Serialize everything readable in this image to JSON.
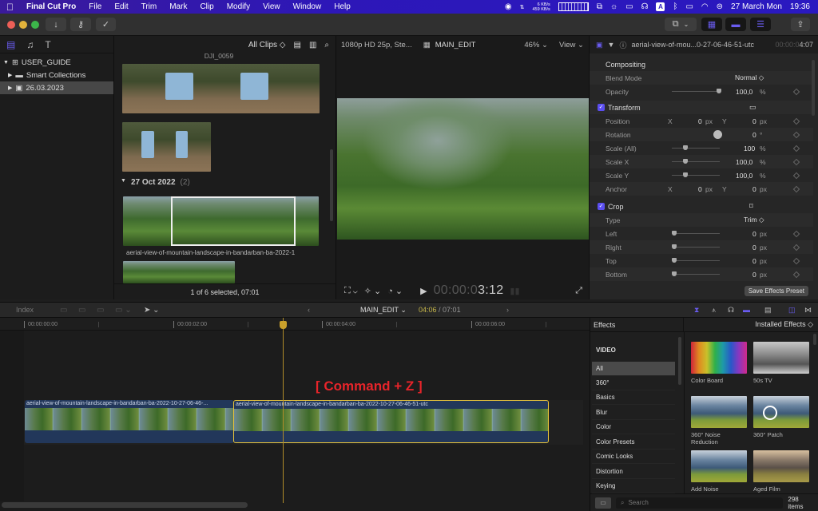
{
  "menubar": {
    "apple": "",
    "app_name": "Final Cut Pro",
    "menus": [
      "File",
      "Edit",
      "Trim",
      "Mark",
      "Clip",
      "Modify",
      "View",
      "Window",
      "Help"
    ],
    "net_up": "6 KB/s",
    "net_down": "459 KB/s",
    "input_source": "A",
    "date": "27 March Mon",
    "time": "19:36"
  },
  "toolbar": {
    "import_icon": "↓",
    "keyword_icon": "⚷",
    "check_icon": "✓"
  },
  "library": {
    "name": "USER_GUIDE",
    "items": [
      {
        "label": "Smart Collections",
        "icon": "folder-icon"
      },
      {
        "label": "26.03.2023",
        "icon": "event-icon",
        "selected": true
      }
    ]
  },
  "browser": {
    "filter": "All Clips",
    "clip1_name": "DJI_0059",
    "group_date": "27 Oct 2022",
    "group_count": "(2)",
    "clip2_name": "aerial-view-of-mountain-landscape-in-bandarban-ba-2022-1",
    "status": "1 of 6 selected, 07:01"
  },
  "viewer": {
    "format": "1080p HD 25p, Ste...",
    "project": "MAIN_EDIT",
    "zoom": "46%",
    "view_label": "View",
    "timecode_dim": "00:00:0",
    "timecode_lit": "3:12"
  },
  "inspector": {
    "clip_name": "aerial-view-of-mou...0-27-06-46-51-utc",
    "duration_dim": "00:00:0",
    "duration_lit": "4:07",
    "compositing": {
      "title": "Compositing",
      "blend_mode_label": "Blend Mode",
      "blend_mode_value": "Normal ◇",
      "opacity_label": "Opacity",
      "opacity_value": "100,0",
      "opacity_unit": "%"
    },
    "transform": {
      "title": "Transform",
      "position_label": "Position",
      "position_x": "0",
      "position_y": "0",
      "rotation_label": "Rotation",
      "rotation_value": "0",
      "rotation_unit": "°",
      "scale_all_label": "Scale (All)",
      "scale_all_value": "100",
      "scale_x_label": "Scale X",
      "scale_x_value": "100,0",
      "scale_y_label": "Scale Y",
      "scale_y_value": "100,0",
      "anchor_label": "Anchor",
      "anchor_x": "0",
      "anchor_y": "0",
      "unit_px": "px",
      "unit_pct": "%",
      "x_label": "X",
      "y_label": "Y"
    },
    "crop": {
      "title": "Crop",
      "type_label": "Type",
      "type_value": "Trim ◇",
      "left_label": "Left",
      "left_value": "0",
      "right_label": "Right",
      "right_value": "0",
      "top_label": "Top",
      "top_value": "0",
      "bottom_label": "Bottom",
      "bottom_value": "0"
    },
    "save_preset": "Save Effects Preset"
  },
  "timeline_bar": {
    "index": "Index",
    "project": "MAIN_EDIT",
    "position": "04:06",
    "duration": "/ 07:01"
  },
  "timeline": {
    "ticks": [
      "00:00:00:00",
      "00:00:02:00",
      "00:00:04:00",
      "00:00:06:00"
    ],
    "overlay": "[ Command + Z ]",
    "clips": [
      {
        "label": "aerial-view-of-mountain-landscape-in-bandarban-ba-2022-10-27-06-46-...",
        "selected": false
      },
      {
        "label": "aerial-view-of-mountain-landscape-in-bandarban-ba-2022-10-27-06-46-51-utc",
        "selected": true
      }
    ]
  },
  "effects": {
    "title": "Effects",
    "source": "Installed Effects ◇",
    "section": "VIDEO",
    "categories": [
      "All",
      "360°",
      "Basics",
      "Blur",
      "Color",
      "Color Presets",
      "Comic Looks",
      "Distortion",
      "Keying"
    ],
    "items": [
      "Color Board",
      "50s TV",
      "360° Noise Reduction",
      "360° Patch",
      "Add Noise",
      "Aged Film"
    ],
    "search_placeholder": "Search",
    "count": "298 items"
  }
}
